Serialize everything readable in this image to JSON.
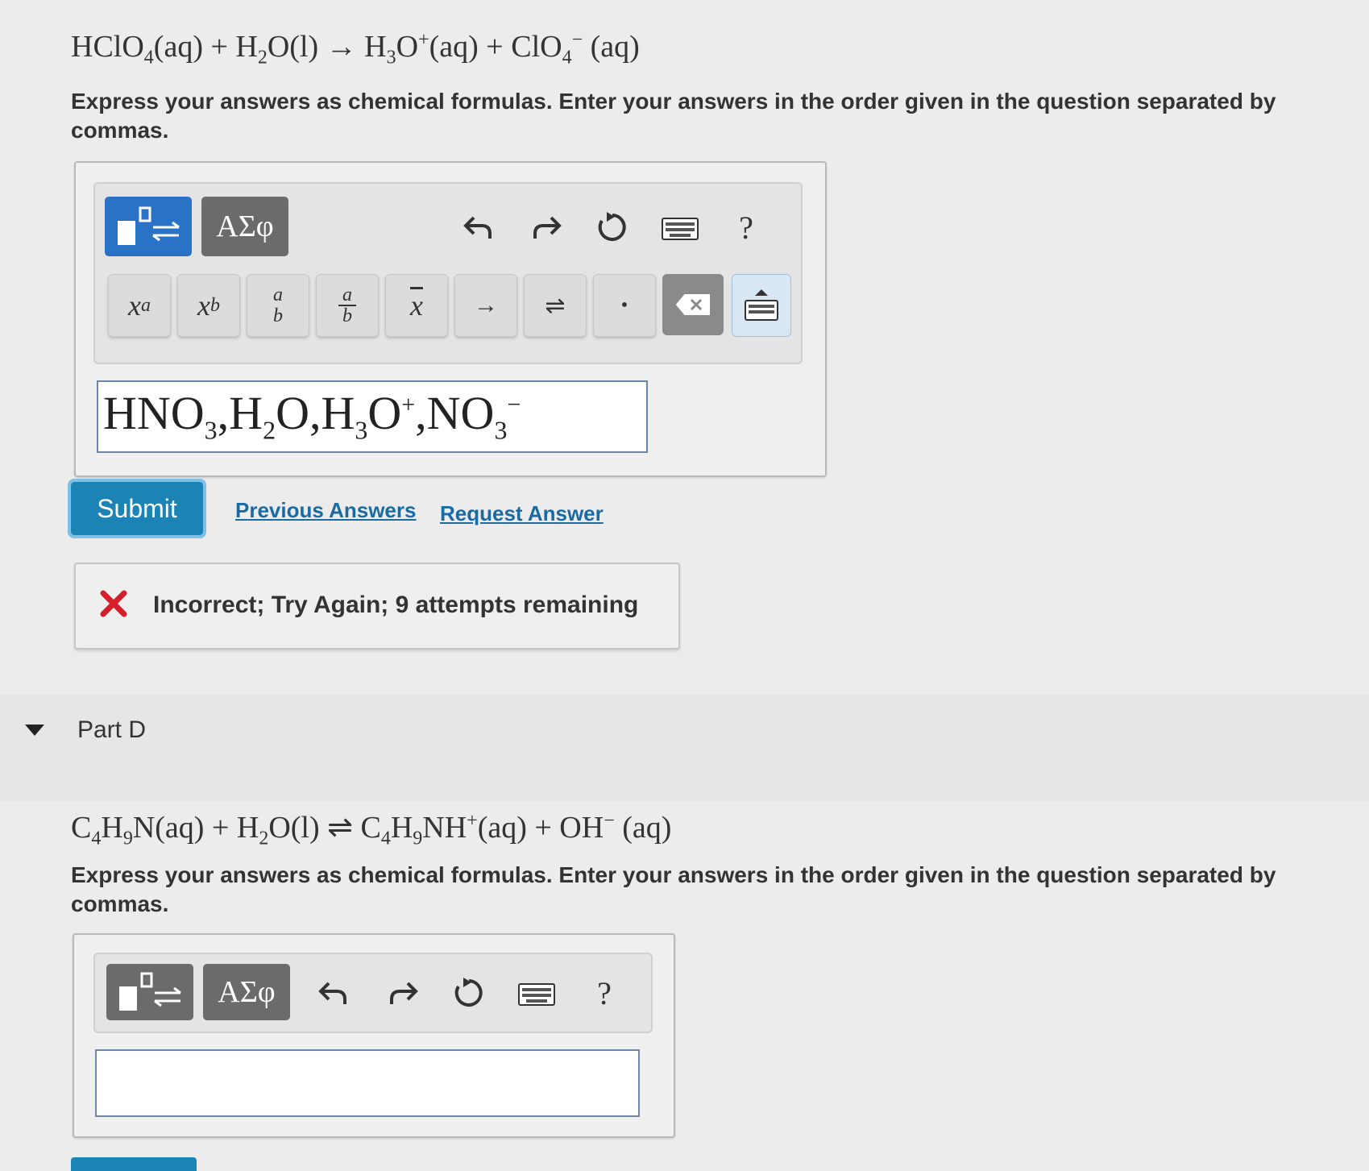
{
  "partC": {
    "equation": {
      "t1": "HClO",
      "s1": "4",
      "t2": "(aq) + H",
      "s2": "2",
      "t3": "O(l) → H",
      "s3": "3",
      "t4": "O",
      "p1": "+",
      "t5": "(aq) + ClO",
      "s4": "4",
      "p2": "−",
      "t6": " (aq)"
    },
    "instructions": "Express your answers as chemical formulas. Enter your answers in the order given in the question separated by commas.",
    "toolbar": {
      "greek_label": "ΑΣφ",
      "help_label": "?",
      "keys": {
        "superscript_base": "x",
        "superscript_exp": "a",
        "subscript_base": "x",
        "subscript_sub": "b",
        "frac_num": "a",
        "frac_den": "b",
        "frac2_num": "a",
        "frac2_den": "b",
        "bar_label": "x",
        "arrow_label": "→",
        "equilibrium_label": "⇌",
        "dot_label": "•"
      }
    },
    "answer": {
      "a1": "HNO",
      "a1s": "3",
      "a2": ",H",
      "a2s": "2",
      "a3": "O,H",
      "a3s": "3",
      "a4": "O",
      "a4p": "+",
      "a5": ",NO",
      "a5s": "3",
      "a5p": "−"
    },
    "submit_label": "Submit",
    "previous_answers_label": "Previous Answers",
    "request_answer_label": "Request Answer",
    "feedback_text": "Incorrect; Try Again; 9 attempts remaining"
  },
  "partD": {
    "title": "Part D",
    "equation": {
      "t1": "C",
      "s1": "4",
      "t2": "H",
      "s2": "9",
      "t3": "N(aq) + H",
      "s3": "2",
      "t4": "O(l) ⇌ C",
      "s4": "4",
      "t5": "H",
      "s5": "9",
      "t6": "NH",
      "p1": "+",
      "t7": "(aq) + OH",
      "p2": "−",
      "t8": " (aq)"
    },
    "instructions": "Express your answers as chemical formulas. Enter your answers in the order given in the question separated by commas.",
    "toolbar": {
      "greek_label": "ΑΣφ",
      "help_label": "?"
    },
    "input_value": ""
  },
  "colors": {
    "accent": "#2a72c6",
    "submit": "#1c84b5",
    "link": "#1a6aa3",
    "error": "#d4202a"
  }
}
